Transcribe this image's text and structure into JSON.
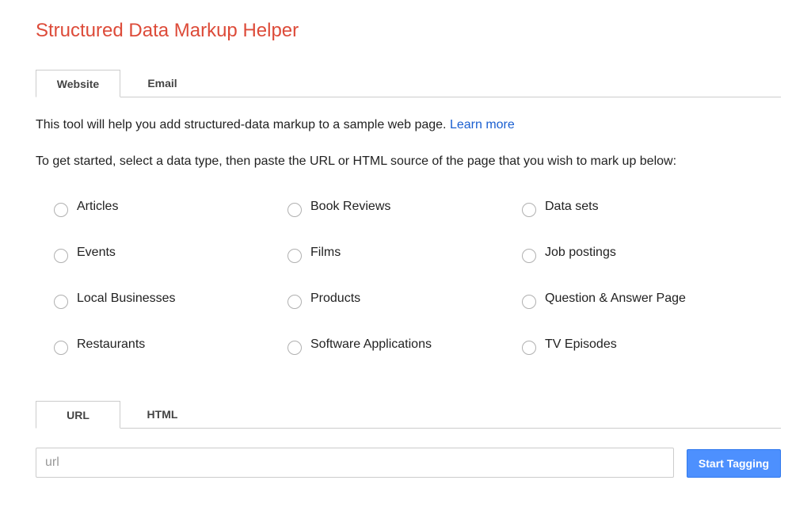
{
  "app": {
    "title": "Structured Data Markup Helper"
  },
  "top_tabs": [
    {
      "label": "Website",
      "active": true
    },
    {
      "label": "Email",
      "active": false
    }
  ],
  "intro": {
    "text": "This tool will help you add structured-data markup to a sample web page.",
    "link_label": "Learn more",
    "instructions": "To get started, select a data type, then paste the URL or HTML source of the page that you wish to mark up below:"
  },
  "data_types": [
    {
      "label": "Articles",
      "selected": false
    },
    {
      "label": "Book Reviews",
      "selected": false
    },
    {
      "label": "Data sets",
      "selected": false
    },
    {
      "label": "Events",
      "selected": false
    },
    {
      "label": "Films",
      "selected": false
    },
    {
      "label": "Job postings",
      "selected": false
    },
    {
      "label": "Local Businesses",
      "selected": false
    },
    {
      "label": "Products",
      "selected": false
    },
    {
      "label": "Question & Answer Page",
      "selected": false
    },
    {
      "label": "Restaurants",
      "selected": false
    },
    {
      "label": "Software Applications",
      "selected": false
    },
    {
      "label": "TV Episodes",
      "selected": false
    }
  ],
  "source_tabs": [
    {
      "label": "URL",
      "active": true
    },
    {
      "label": "HTML",
      "active": false
    }
  ],
  "url_input": {
    "value": "",
    "placeholder": "url"
  },
  "start_button": {
    "label": "Start Tagging"
  },
  "colors": {
    "title": "#dd4b39",
    "link": "#1a5fd0",
    "primary_button": "#4d90fe"
  }
}
